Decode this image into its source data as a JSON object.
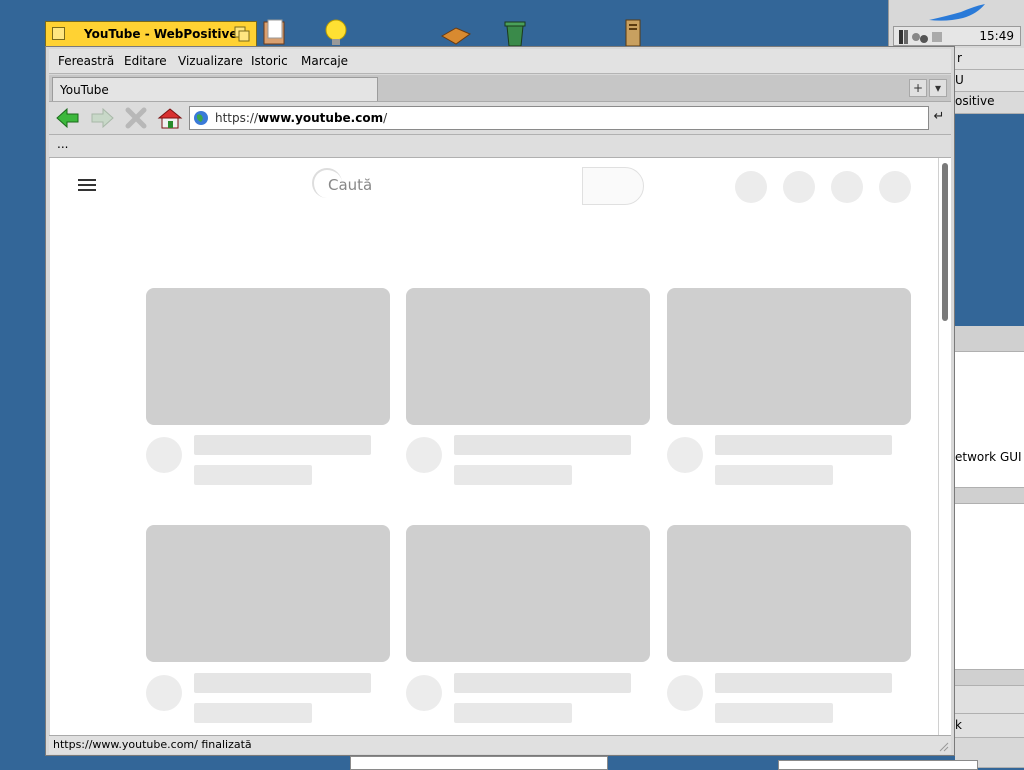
{
  "window": {
    "title": "YouTube - WebPositive"
  },
  "menubar": {
    "items": [
      "Fereastră",
      "Editare",
      "Vizualizare",
      "Istoric",
      "Marcaje"
    ]
  },
  "tabs": {
    "active_label": "YouTube",
    "new_tab_label": "+",
    "tab_menu_label": "▾"
  },
  "navbar": {
    "url_prefix": "https://",
    "url_host": "www.youtube.com",
    "url_suffix": "/",
    "go_label": "↵"
  },
  "bookmarks": {
    "overflow_label": "..."
  },
  "page": {
    "search_placeholder": "Caută"
  },
  "status": {
    "text": "https://www.youtube.com/ finalizată"
  },
  "deskbar": {
    "clock": "15:49"
  },
  "background_windows": {
    "fragments": [
      "r",
      "U",
      "ositive",
      "etwork GUI ty",
      "k"
    ]
  },
  "colors": {
    "desktop": "#336698",
    "title_tab": "#ffd233",
    "skeleton_thumb": "#cfcfcf",
    "skeleton_line": "#e5e5e5"
  },
  "icons": {
    "back": "back-arrow-icon",
    "forward": "forward-arrow-icon",
    "stop": "stop-x-icon",
    "home": "home-icon",
    "globe": "globe-icon"
  }
}
